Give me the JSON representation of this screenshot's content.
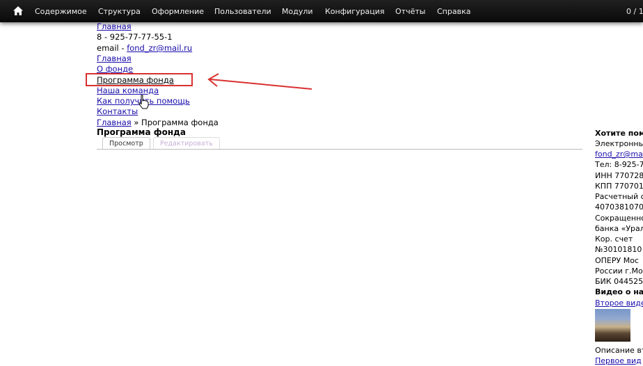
{
  "toolbar": {
    "items": [
      "Содержимое",
      "Структура",
      "Оформление",
      "Пользователи",
      "Модули",
      "Конфигурация",
      "Отчёты",
      "Справка"
    ],
    "counter": "0 / 1"
  },
  "header": {
    "home_link": "Главная",
    "phone": "8 - 925-77-77-55-1",
    "email_label": "email - ",
    "email_link": "fond_zr@mail.ru"
  },
  "nav": {
    "items": [
      "Главная",
      "О фонде",
      "Программа фонда",
      "Наша команда",
      "Как получить помощь",
      "Контакты"
    ]
  },
  "breadcrumb": {
    "home": "Главная",
    "separator": " » ",
    "current": "Программа фонда"
  },
  "page": {
    "title": "Программа фонда",
    "tab_view": "Просмотр",
    "tab_edit": "Редактировать"
  },
  "sidebar": {
    "heading": "Хотите пом",
    "lines": [
      "Электронны",
      "fond_zr@ma",
      "Тел: 8-925-7",
      "ИНН 770728",
      "КПП 770701",
      "Расчетный с",
      "4070381070",
      "Сокращенно",
      "банка «Урал",
      "Кор. счет",
      "№30101810",
      "ОПЕРУ Мос",
      "России г.Мо",
      "БИК 044525"
    ],
    "video_heading": "Видео о на",
    "video_link_1": "Второе виде",
    "video_desc": "Описание вт",
    "video_link_2": "Первое вид"
  }
}
